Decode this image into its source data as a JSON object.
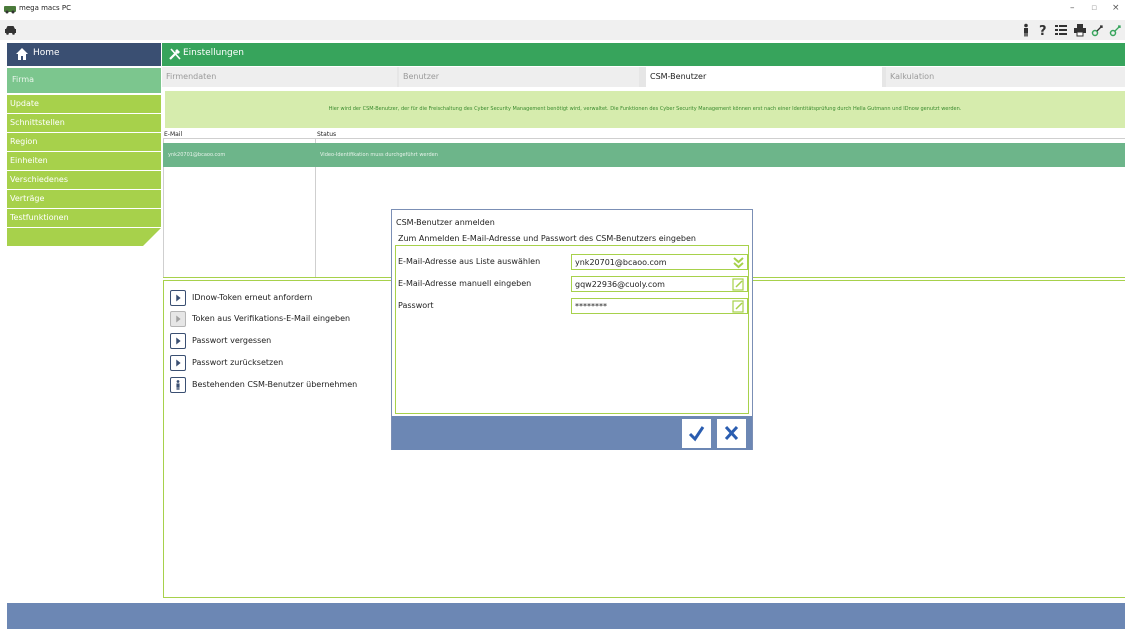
{
  "window": {
    "title": "mega macs PC",
    "controls": [
      "–",
      "▫",
      "×"
    ]
  },
  "toolbar": {
    "icons": [
      "car-icon",
      "person-icon",
      "help-icon",
      "list-icon",
      "print-icon",
      "connection-icon",
      "connection-icon-2"
    ]
  },
  "sidebar": {
    "home_label": "Home",
    "section_label": "Firma",
    "items": [
      {
        "label": "Update"
      },
      {
        "label": "Schnittstellen"
      },
      {
        "label": "Region"
      },
      {
        "label": "Einheiten"
      },
      {
        "label": "Verschiedenes"
      },
      {
        "label": "Verträge"
      },
      {
        "label": "Testfunktionen"
      }
    ]
  },
  "header": {
    "title": "Einstellungen"
  },
  "tabs": [
    {
      "label": "Firmendaten",
      "active": false
    },
    {
      "label": "Benutzer",
      "active": false
    },
    {
      "label": "CSM-Benutzer",
      "active": true
    },
    {
      "label": "Kalkulation",
      "active": false
    }
  ],
  "info_text": "Hier wird der CSM-Benutzer, der für die Freischaltung des Cyber Security Management benötigt wird, verwaltet. Die Funktionen des Cyber Security Management können erst nach einer Identitätsprüfung durch Hella Gutmann und IDnow genutzt werden.",
  "table": {
    "columns": [
      "E-Mail",
      "Status"
    ],
    "rows": [
      {
        "email": "ynk20701@bcaoo.com",
        "status": "Video-Identifikation muss durchgeführt werden"
      }
    ]
  },
  "actions": [
    {
      "label": "IDnow-Token erneut anfordern",
      "enabled": true
    },
    {
      "label": "Token aus Verifikations-E-Mail eingeben",
      "enabled": false
    },
    {
      "label": "Passwort vergessen",
      "enabled": true
    },
    {
      "label": "Passwort zurücksetzen",
      "enabled": true
    },
    {
      "label": "Bestehenden CSM-Benutzer übernehmen",
      "enabled": true
    }
  ],
  "dialog": {
    "title": "CSM-Benutzer anmelden",
    "subtitle": "Zum Anmelden E-Mail-Adresse und Passwort des CSM-Benutzers eingeben",
    "fields": [
      {
        "label": "E-Mail-Adresse aus Liste auswählen",
        "value": "ynk20701@bcaoo.com"
      },
      {
        "label": "E-Mail-Adresse manuell eingeben",
        "value": "gqw22936@cuoly.com"
      },
      {
        "label": "Passwort",
        "value": "********"
      }
    ]
  },
  "colors": {
    "nav_blue": "#3a4f72",
    "header_green": "#37a45c",
    "sidebar_green": "#a7d14b",
    "firma_green": "#7cc68e",
    "selected_row": "#6db58a",
    "footer_blue": "#6c87b4",
    "check_blue": "#2a5db0"
  }
}
